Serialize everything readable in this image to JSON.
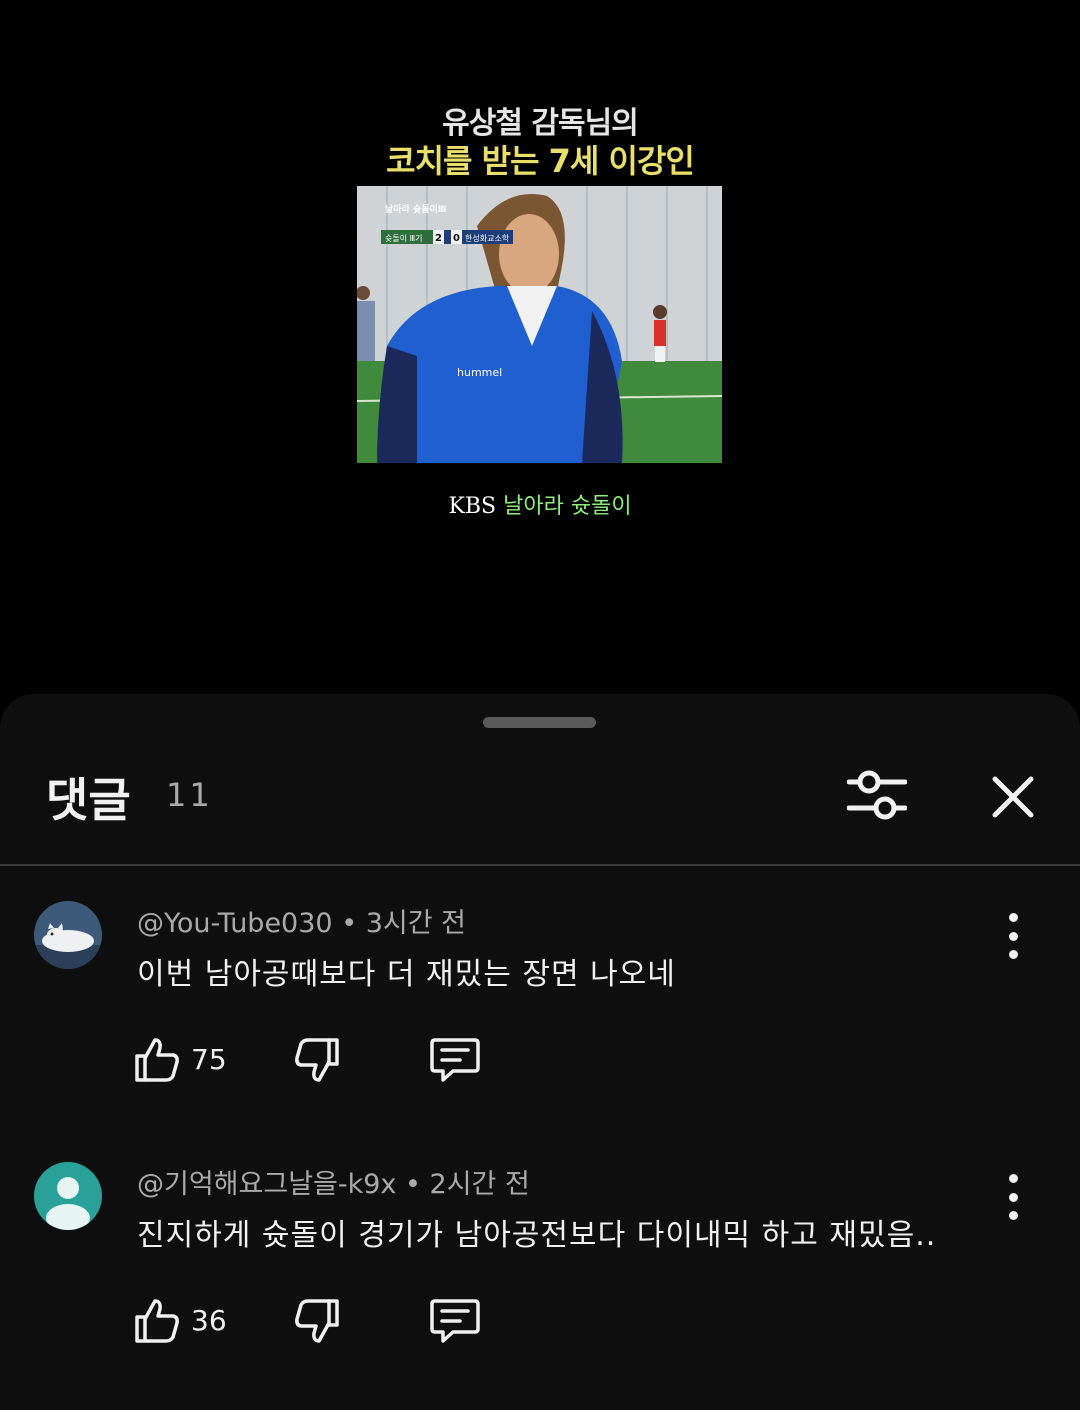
{
  "video": {
    "caption_line1": "유상철 감독님의",
    "caption_line2": "코치를 받는 7세 이강인",
    "overlay_logo": "날아라 슛돌이Ⅲ",
    "score_left_team": "슛돌이 Ⅲ기",
    "score_left": "2",
    "score_right": "0",
    "score_right_team": "한성화교소학",
    "jersey_text": "hummel",
    "credit_channel": "KBS",
    "credit_show": "날아라 슛돌이"
  },
  "comments_panel": {
    "title": "댓글",
    "count": "11",
    "filter_icon": "sliders-icon",
    "close_icon": "close-icon"
  },
  "comments": [
    {
      "author": "@You-Tube030",
      "time": "3시간 전",
      "text": "이번 남아공때보다 더 재밌는 장면 나오네",
      "likes": "75",
      "avatar": "cat-photo-avatar"
    },
    {
      "author": "@기억해요그날을-k9x",
      "time": "2시간 전",
      "text": "진지하게 슛돌이 경기가 남아공전보다 다이내믹 하고 재밌음..",
      "likes": "36",
      "avatar": "default-person-avatar",
      "avatar_color": "#2aa198"
    }
  ],
  "colors": {
    "sheet_bg": "#0f0f0f",
    "caption_yellow": "#e8e06a",
    "credit_green": "#8ef07a"
  }
}
